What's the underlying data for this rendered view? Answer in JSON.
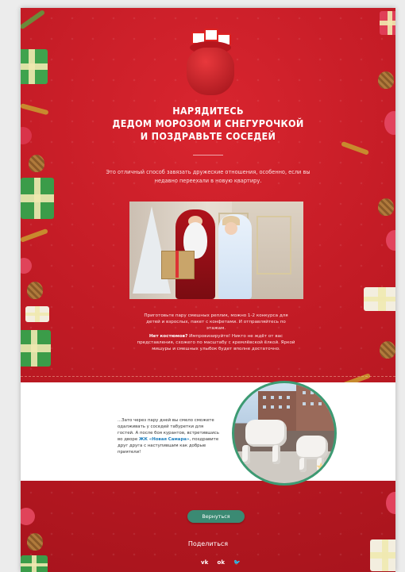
{
  "title": {
    "line1": "НАРЯДИТЕСЬ",
    "line2": "ДЕДОМ МОРОЗОМ И СНЕГУРОЧКОЙ",
    "line3": "И ПОЗДРАВЬТЕ СОСЕДЕЙ"
  },
  "intro": "Это отличный способ завязать дружеские отношения, особенно, если вы недавно переехали в новую квартиру.",
  "paragraph1": "Приготовьте пару смешных реплик, можно 1-2 конкурса для детей и взрослых, пакет с конфетами. И отправляйтесь по этажам.",
  "paragraph2": {
    "bold": "Нет костюмов?",
    "rest": " Импровизируйте! Никто не ждёт от вас представления, схожего по масштабу с кремлёвской ёлкой. Яркой мишуры и смешных улыбок будет вполне достаточно."
  },
  "white_section": {
    "text_before": "...Зато через пару дней вы смело сможете одалживать у соседей табуретки для гостей. А после боя курантов, встретившись во дворе ",
    "link": "ЖК «Новая Самара»",
    "text_after": ", поздравите друг друга с наступившим как добрые приятели!"
  },
  "back_button": "Вернуться",
  "share_label": "Поделиться",
  "social": {
    "vk": "vk-icon",
    "ok": "odnoklassniki-icon",
    "twitter": "twitter-icon"
  },
  "colors": {
    "background_red": "#c41d28",
    "button_green": "#3b8a73",
    "link_blue": "#1f7fbf"
  }
}
